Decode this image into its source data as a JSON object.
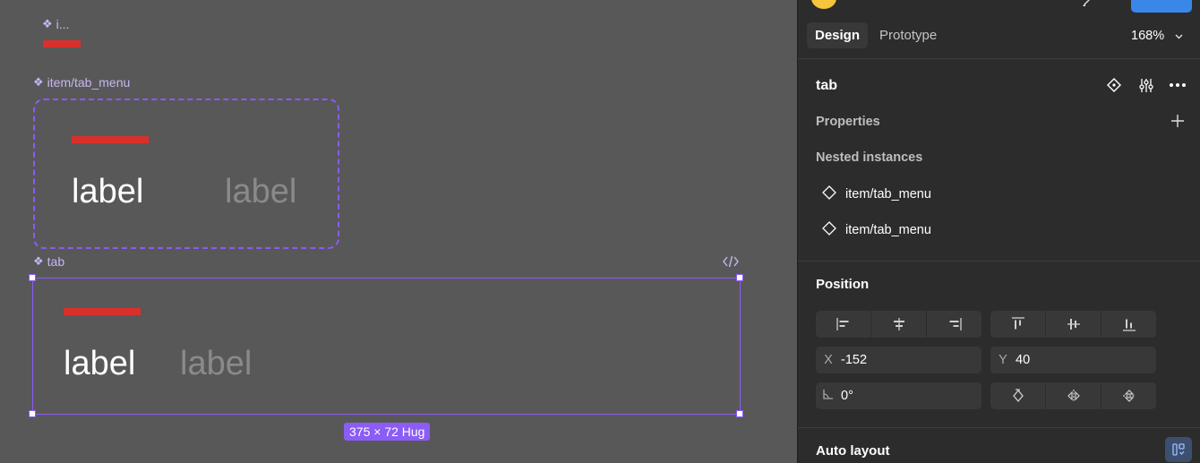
{
  "canvas": {
    "top_component": {
      "label": "i..."
    },
    "component_item": {
      "label": "item/tab_menu",
      "tab_active": "label",
      "tab_inactive": "label"
    },
    "component_tab": {
      "label": "tab",
      "tab_active": "label",
      "tab_inactive": "label",
      "size_badge": "375 × 72 Hug"
    }
  },
  "panel": {
    "tabs": [
      {
        "label": "Design"
      },
      {
        "label": "Prototype"
      }
    ],
    "zoom": "168%",
    "layer_name": "tab",
    "properties_label": "Properties",
    "nested_label": "Nested instances",
    "nested_instances": [
      {
        "label": "item/tab_menu"
      },
      {
        "label": "item/tab_menu"
      }
    ],
    "position_label": "Position",
    "x_prefix": "X",
    "x_value": "-152",
    "y_prefix": "Y",
    "y_value": "40",
    "rotation_value": "0°",
    "auto_layout_label": "Auto layout"
  },
  "colors": {
    "accent": "#8b5cf6",
    "red_indicator": "#d9302c",
    "canvas_bg": "#585858",
    "panel_bg": "#2c2c2c",
    "share_blue": "#3a87ea"
  }
}
